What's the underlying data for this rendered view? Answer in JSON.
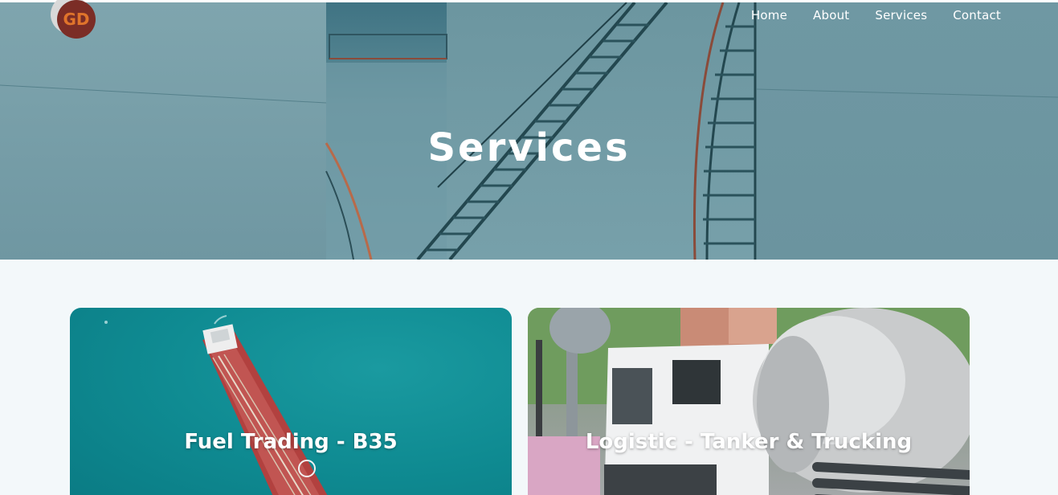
{
  "brand": {
    "logo_text": "GD",
    "colors": {
      "logo_ring": "#7b2d26",
      "logo_letters": "#e0742b",
      "logo_bg": "#d8d8d8"
    }
  },
  "nav": {
    "items": [
      {
        "label": "Home"
      },
      {
        "label": "About"
      },
      {
        "label": "Services"
      },
      {
        "label": "Contact"
      }
    ]
  },
  "hero": {
    "title": "Services"
  },
  "cards": [
    {
      "title": "Fuel Trading - B35",
      "image": "oil-tanker-ship-aerial"
    },
    {
      "title": "Logistic - Tanker & Trucking",
      "image": "fuel-tanker-truck"
    }
  ],
  "colors": {
    "page_bg": "#f3f8fa",
    "hero_overlay": "#6a939e",
    "text_on_image": "#ffffff"
  }
}
